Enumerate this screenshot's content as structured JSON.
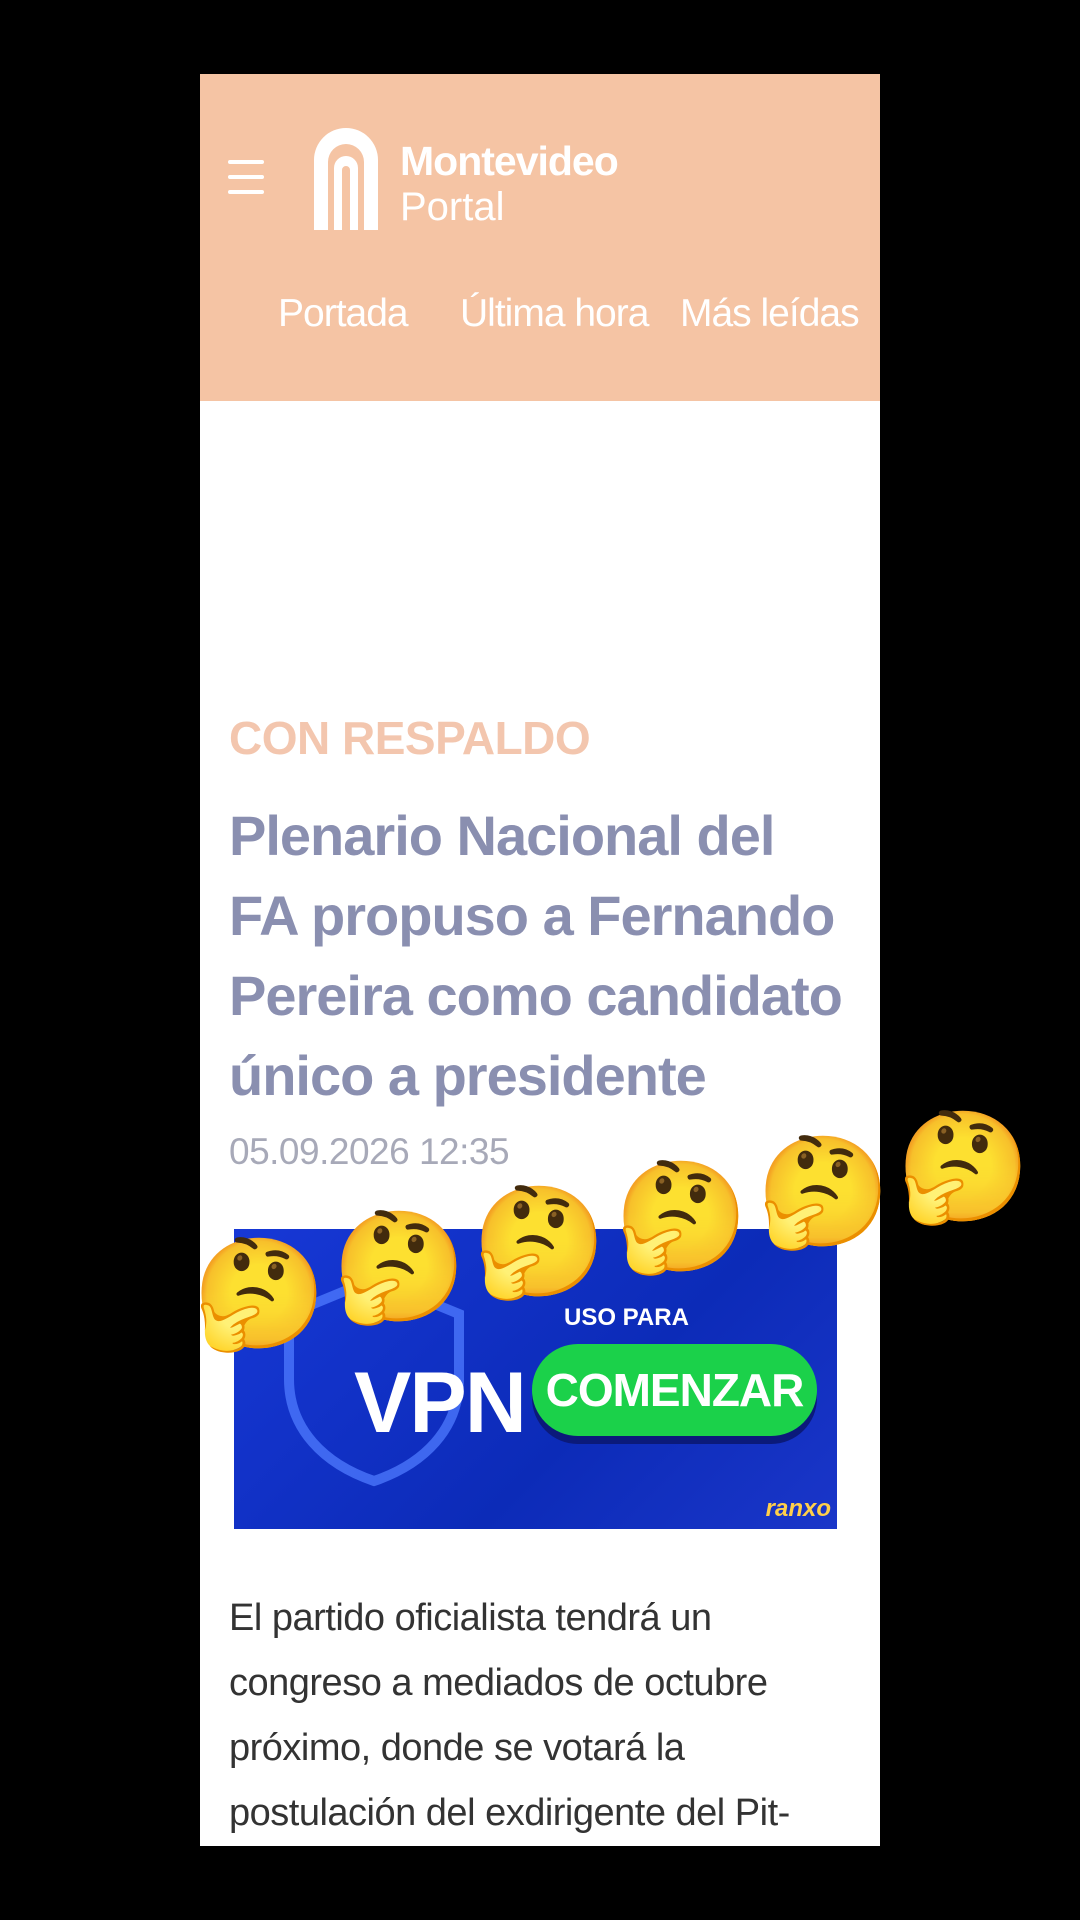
{
  "header": {
    "menu_icon": "hamburger-menu-icon",
    "logo": {
      "line1": "Montevideo",
      "line2": "Portal"
    },
    "nav": [
      "Portada",
      "Última hora",
      "Más leídas"
    ],
    "background_color": "#f5c4a4"
  },
  "article": {
    "kicker": "CON RESPALDO",
    "title": "Plenario Nacional del FA propuso a Fernando Pereira como candidato único a presidente",
    "date": "05.09.2026 12:35",
    "lead": "El partido oficialista tendrá un congreso a mediados de octubre próximo, donde se votará la postulación del exdirigente del Pit-Cnt."
  },
  "ad": {
    "headline_partial": "VPN",
    "small_text": "USO PARA",
    "cta": "COMENZAR",
    "brand": "ranxo",
    "cta_color": "#1bd14a",
    "background_color": "#1738d6"
  },
  "overlay": {
    "emoji": "🤔",
    "emoji_name": "thinking-face-emoji",
    "count": 6
  }
}
